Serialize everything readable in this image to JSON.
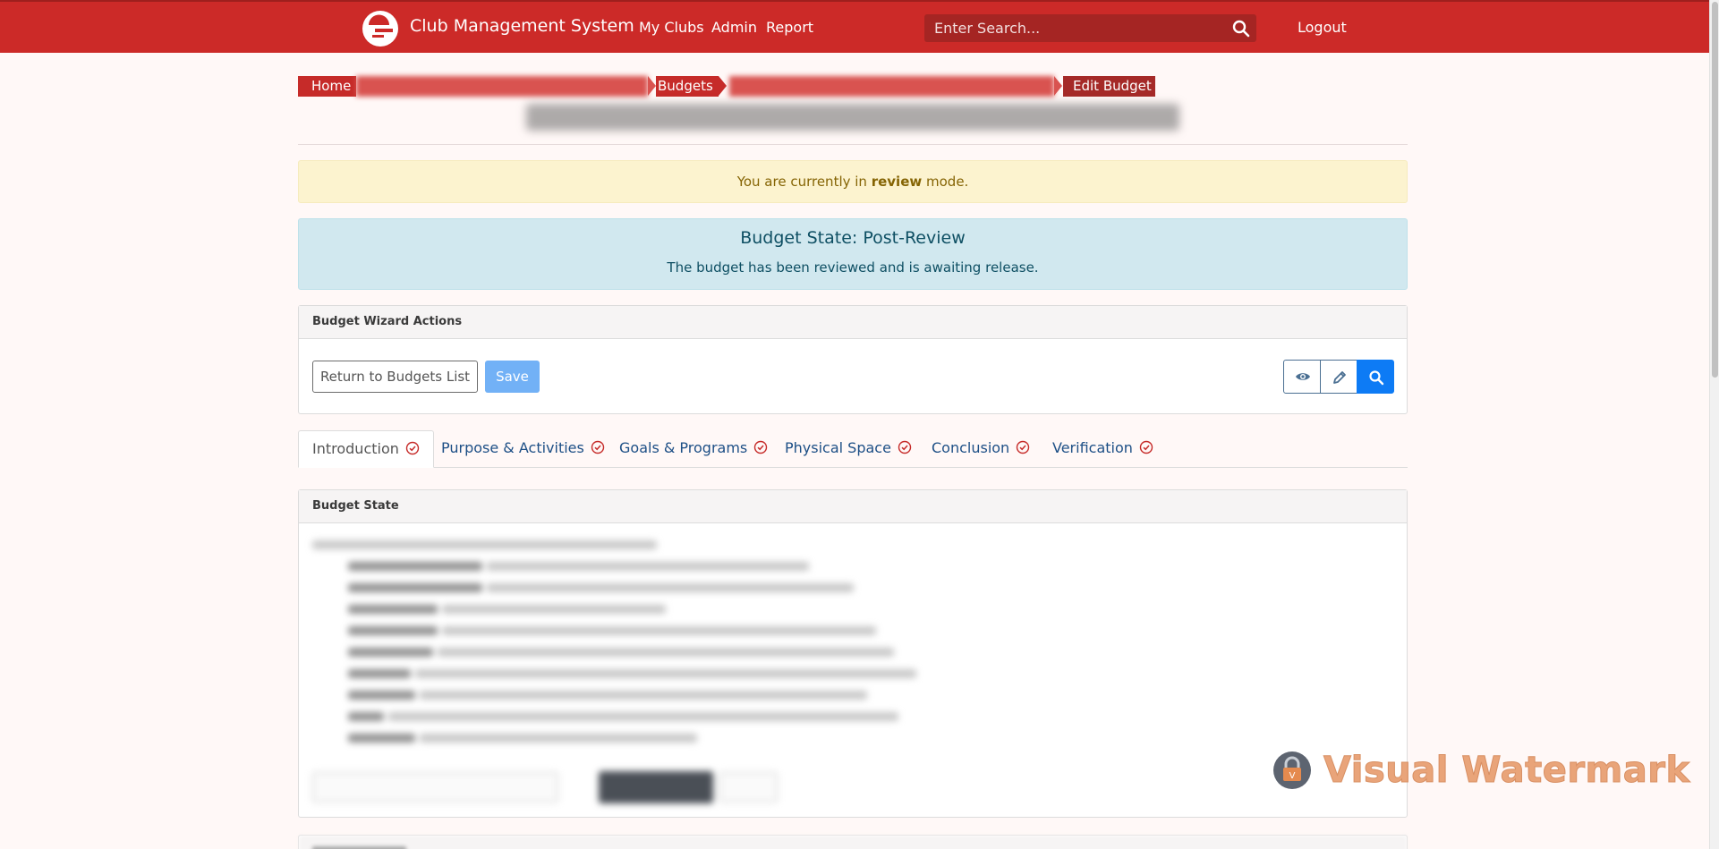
{
  "navbar": {
    "brand": "Club Management System",
    "links": [
      "My Clubs",
      "Admin",
      "Report"
    ],
    "search_placeholder": "Enter Search...",
    "logout": "Logout"
  },
  "breadcrumb": {
    "home": "Home",
    "budgets": "Budgets",
    "edit_budget": "Edit Budget"
  },
  "alerts": {
    "review_prefix": "You are currently in ",
    "review_bold": "review",
    "review_suffix": " mode.",
    "state_title": "Budget State: Post-Review",
    "state_desc": "The budget has been reviewed and is awaiting release."
  },
  "wizard": {
    "header": "Budget Wizard Actions",
    "return_label": "Return to Budgets List",
    "save_label": "Save"
  },
  "tabs": [
    "Introduction",
    "Purpose & Activities",
    "Goals & Programs",
    "Physical Space",
    "Conclusion",
    "Verification"
  ],
  "budget_state_card": {
    "header": "Budget State"
  },
  "watermark": "Visual Watermark",
  "colors": {
    "navbar": "#cc2a28",
    "accent_blue": "#0d7bf5",
    "tab_check": "#c62b29"
  }
}
